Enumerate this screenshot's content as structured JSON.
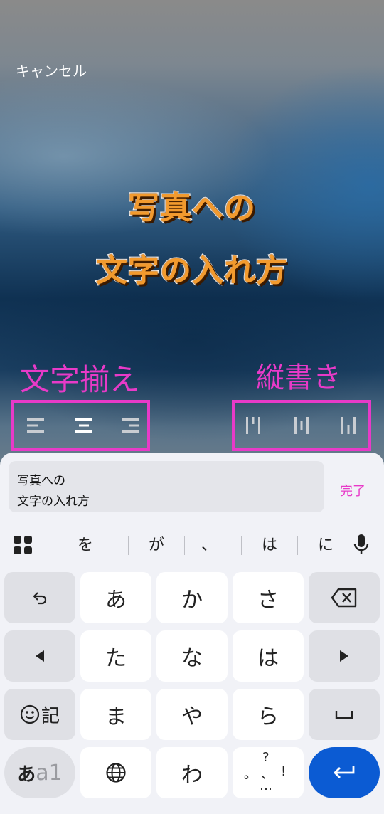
{
  "header": {
    "cancel_label": "キャンセル"
  },
  "photo_text": {
    "line1": "写真への",
    "line2": "文字の入れ方"
  },
  "annotations": {
    "alignment_label": "文字揃え",
    "vertical_label": "縦書き"
  },
  "text_input": {
    "line1": "写真への",
    "line2": "文字の入れ方",
    "done_label": "完了"
  },
  "suggestions": [
    "を",
    "が",
    "、",
    "は",
    "に"
  ],
  "keyboard": {
    "row1": [
      "あ",
      "か",
      "さ"
    ],
    "row2": [
      "た",
      "な",
      "は"
    ],
    "row3": [
      "ま",
      "や",
      "ら"
    ],
    "row4_wa": "わ",
    "emoji_label": "記",
    "mode_label_main": "あ",
    "mode_label_sub": "a1",
    "punct_top": "?",
    "punct_left": "。",
    "punct_mid": "、",
    "punct_right": "!",
    "punct_bottom": "…"
  },
  "colors": {
    "accent": "#e83ac8",
    "photo_text": "#f29a2e",
    "enter_key": "#0b5bd3",
    "done": "#e83ac8"
  },
  "icons": [
    "undo-icon",
    "backspace-icon",
    "arrow-left-icon",
    "arrow-right-icon",
    "emoji-icon",
    "space-icon",
    "globe-icon",
    "enter-icon",
    "app-grid-icon",
    "microphone-icon",
    "align-left-icon",
    "align-center-icon",
    "align-right-icon",
    "vertical-align-top-icon",
    "vertical-align-center-icon",
    "vertical-align-bottom-icon"
  ]
}
